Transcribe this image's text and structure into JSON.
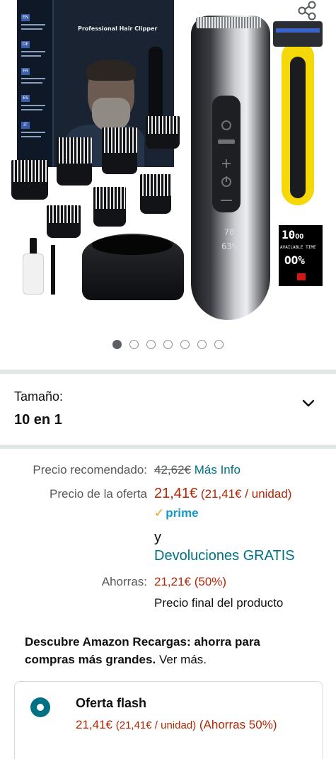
{
  "gallery": {
    "box_title": "Professional Hair Clipper",
    "box_flags": [
      "EN",
      "DE",
      "FR",
      "ES",
      "IT"
    ],
    "clipper_display": [
      "70",
      "63%"
    ],
    "side_display": {
      "time": "10",
      "time_sub": "OO",
      "label": "AVAILABLE TIME",
      "percent": "OO%"
    },
    "image_count": 7,
    "active_image_index": 0
  },
  "size": {
    "label": "Tamaño:",
    "value": "10 en 1"
  },
  "price": {
    "recommended_label": "Precio recomendado:",
    "recommended_value": "42,62€",
    "more_info": "Más Info",
    "offer_label": "Precio de la oferta",
    "offer_value": "21,41€",
    "offer_unit": "(21,41€ / unidad)",
    "prime": "prime",
    "and_text": "y",
    "returns": "Devoluciones GRATIS",
    "savings_label": "Ahorras:",
    "savings_value": "21,21€ (50%)",
    "final_note": "Precio final del producto"
  },
  "promo": {
    "bold": "Descubre Amazon Recargas: ahorra para compras más grandes.",
    "link": "Ver más."
  },
  "offer_card": {
    "title": "Oferta flash",
    "price": "21,41€",
    "unit": "(21,41€ / unidad)",
    "savings": "(Ahorras 50%)"
  },
  "colors": {
    "price_red": "#b12704",
    "link_teal": "#007185",
    "prime_blue": "#1399c6",
    "divider": "#e3e6e6"
  }
}
